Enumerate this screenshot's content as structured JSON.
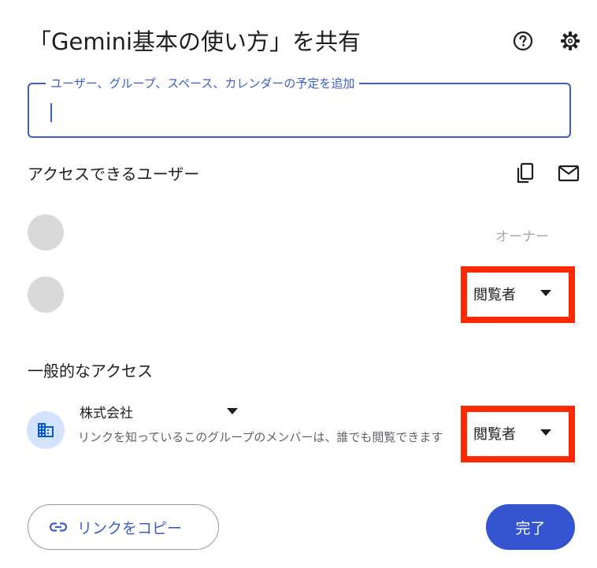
{
  "dialog": {
    "title": "「Gemini基本の使い方」を共有",
    "help_icon": "help-circle-icon",
    "settings_icon": "gear-icon"
  },
  "share_input": {
    "label": "ユーザー、グループ、スペース、カレンダーの予定を追加",
    "value": ""
  },
  "people_section": {
    "title": "アクセスできるユーザー",
    "copy_icon": "copy-icon",
    "email_icon": "mail-icon",
    "people": [
      {
        "role": "オーナー"
      },
      {
        "role": "閲覧者"
      }
    ]
  },
  "general_access": {
    "title": "一般的なアクセス",
    "org_icon": "building-icon",
    "org_name": "株式会社",
    "description": "リンクを知っているこのグループのメンバーは、誰でも閲覧できます",
    "role": "閲覧者"
  },
  "footer": {
    "copy_link_label": "リンクをコピー",
    "done_label": "完了"
  },
  "colors": {
    "accent": "#3555d0",
    "highlight": "#ff2a00",
    "avatar": "#d9d9d9"
  }
}
